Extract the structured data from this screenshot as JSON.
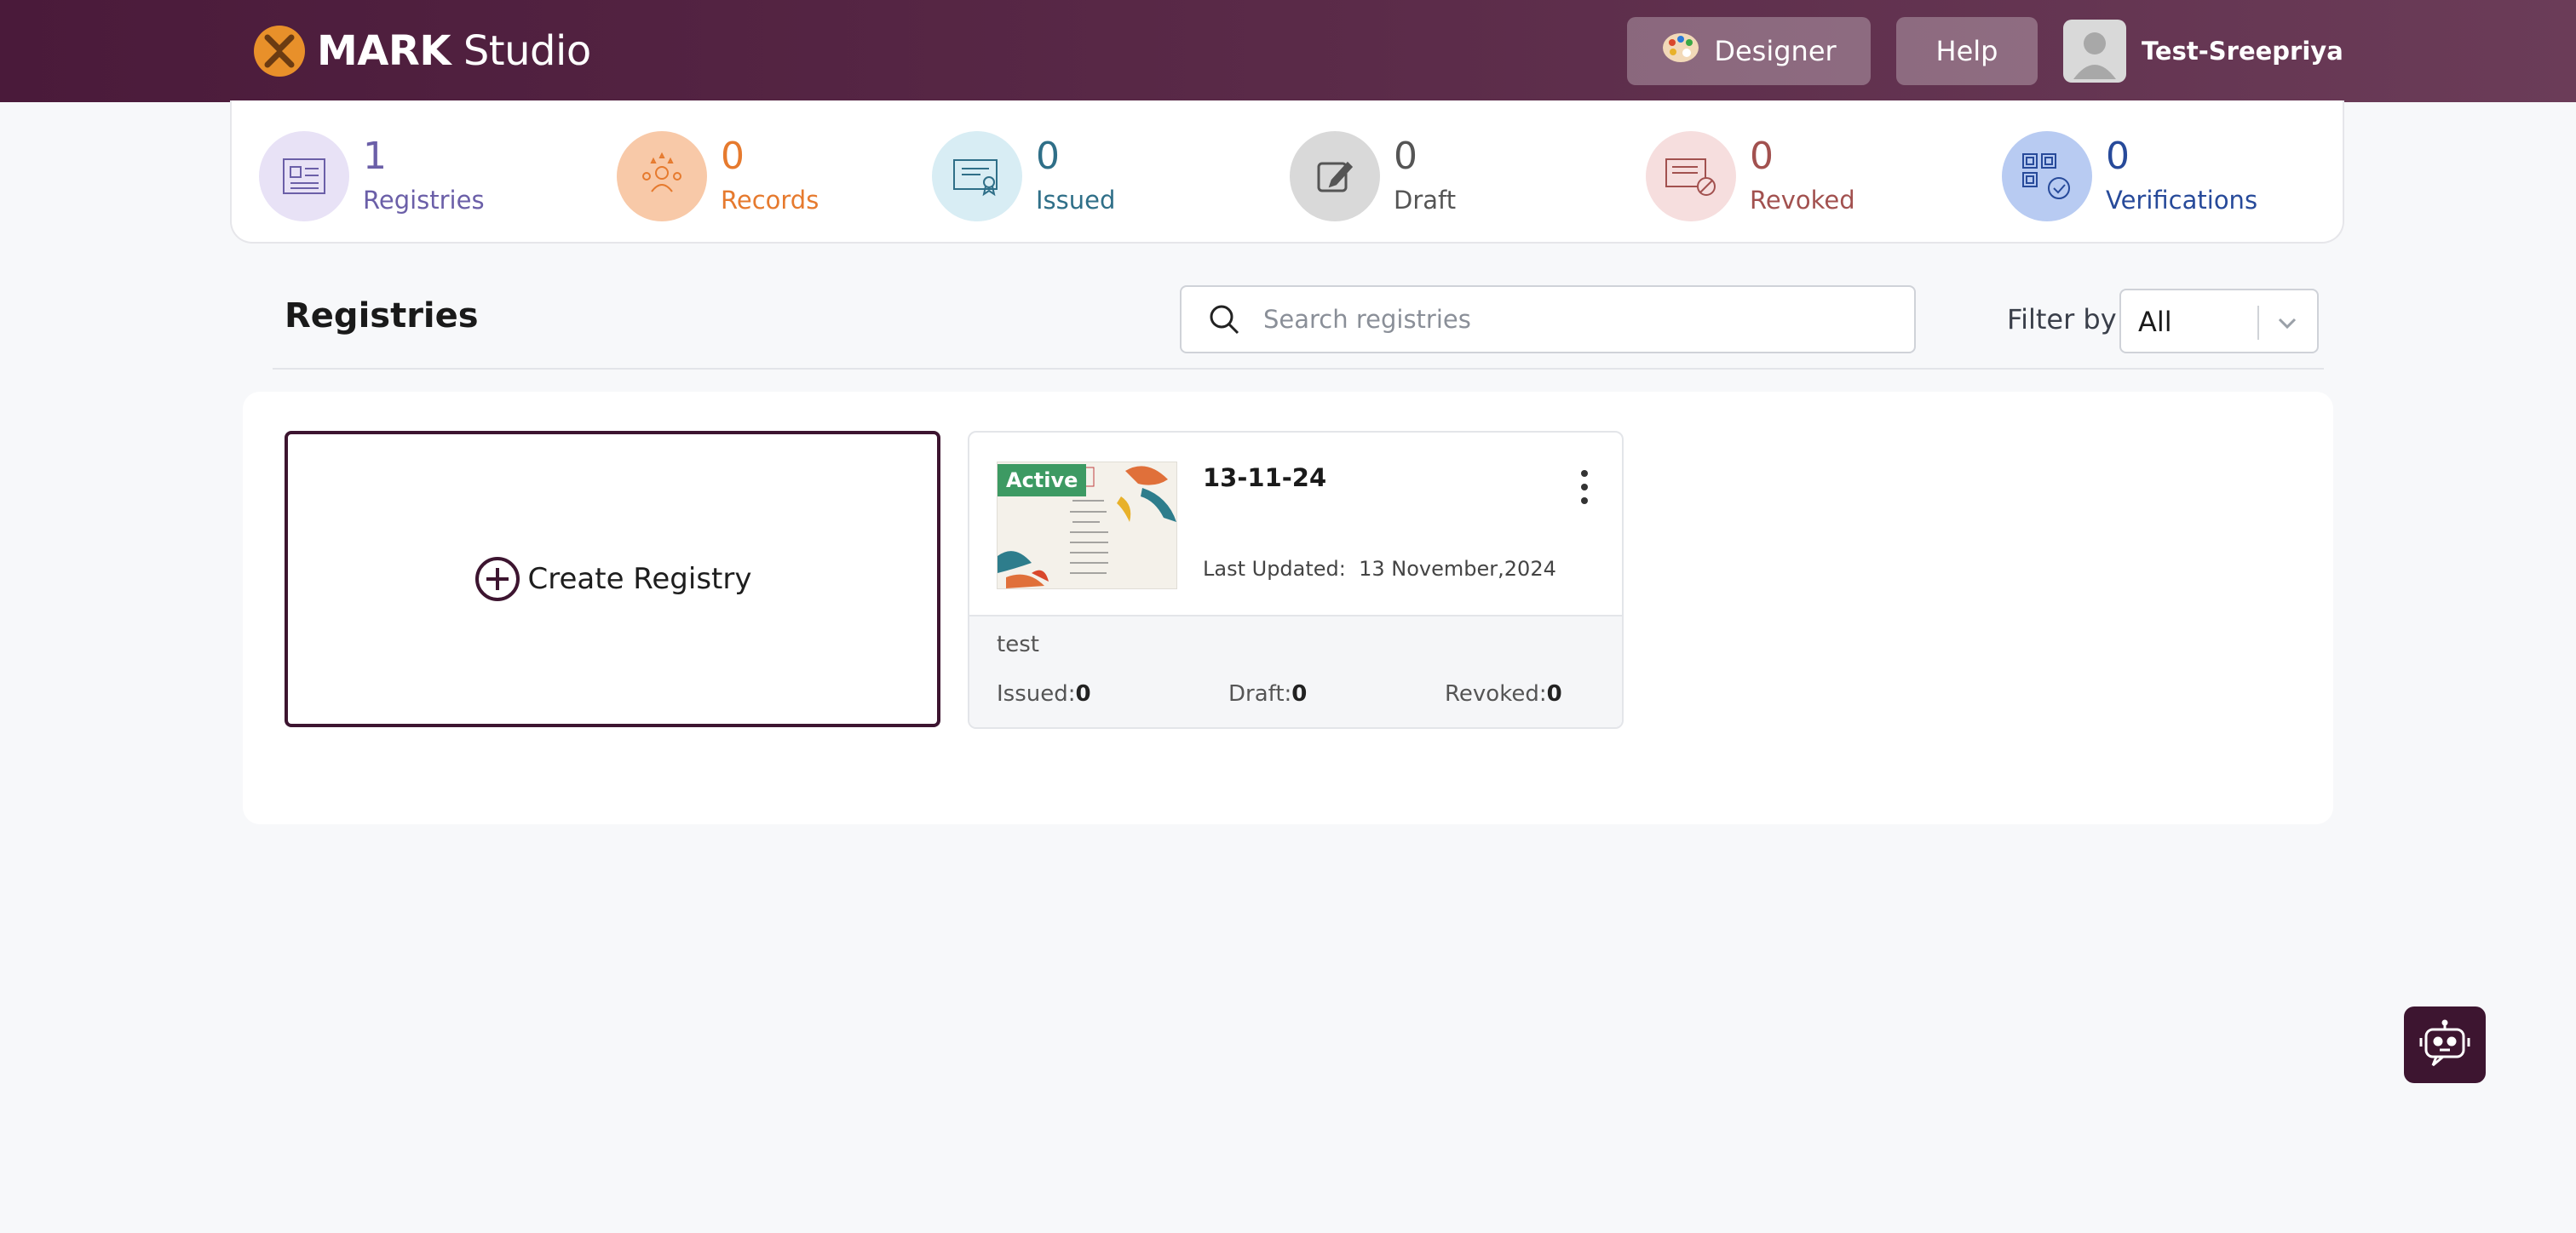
{
  "app": {
    "logo_bold": "MARK",
    "logo_light": " Studio"
  },
  "header": {
    "designer_label": "Designer",
    "help_label": "Help",
    "user_name": "Test-Sreepriya"
  },
  "stats": [
    {
      "value": "1",
      "label": "Registries",
      "color": "#6b5fa8",
      "bg": "#e8e2f6"
    },
    {
      "value": "0",
      "label": "Records",
      "color": "#e67a2e",
      "bg": "#f8c9a8"
    },
    {
      "value": "0",
      "label": "Issued",
      "color": "#2f6f88",
      "bg": "#d8edf4"
    },
    {
      "value": "0",
      "label": "Draft",
      "color": "#555555",
      "bg": "#d9d9d9"
    },
    {
      "value": "0",
      "label": "Revoked",
      "color": "#a2514f",
      "bg": "#f6dede"
    },
    {
      "value": "0",
      "label": "Verifications",
      "color": "#274a9a",
      "bg": "#b8cbf2"
    }
  ],
  "registries": {
    "title": "Registries",
    "search_placeholder": "Search registries",
    "filter_label": "Filter by",
    "filter_value": "All",
    "create_label": "Create Registry",
    "cards": [
      {
        "status": "Active",
        "name": "13-11-24",
        "last_updated_label": "Last Updated:",
        "last_updated_value": "13 November,2024",
        "description": "test",
        "issued_label": "Issued:",
        "issued": "0",
        "draft_label": "Draft:",
        "draft": "0",
        "revoked_label": "Revoked:",
        "revoked": "0"
      }
    ]
  },
  "colors": {
    "brand": "#4a1a3a",
    "accent": "#3d1530",
    "active_badge": "#3d9a63"
  }
}
